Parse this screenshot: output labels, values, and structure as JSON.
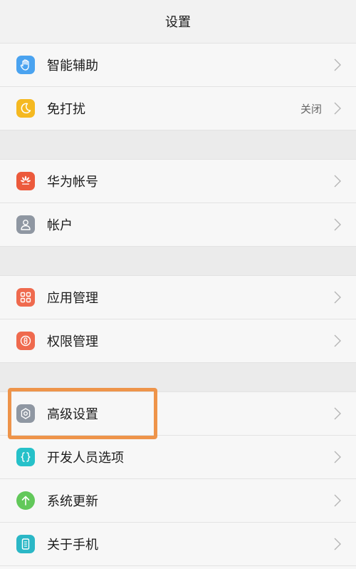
{
  "header": {
    "title": "设置"
  },
  "colors": {
    "highlight": "#ee944a",
    "icon_smart": "#4aa3f0",
    "icon_dnd": "#f5b921",
    "icon_huawei": "#ec5a3c",
    "icon_account": "#8f97a2",
    "icon_apps": "#ef6a4e",
    "icon_permission": "#ef6a4e",
    "icon_advanced": "#8f97a2",
    "icon_developer": "#26c1c9",
    "icon_update": "#62c85a",
    "icon_about": "#2bb7c6"
  },
  "rows": {
    "smart_assist": {
      "label": "智能辅助",
      "icon": "hand-icon"
    },
    "do_not_disturb": {
      "label": "免打扰",
      "value": "关闭",
      "icon": "moon-icon"
    },
    "huawei_account": {
      "label": "华为帐号",
      "icon": "huawei-logo-icon"
    },
    "accounts": {
      "label": "帐户",
      "icon": "person-icon"
    },
    "apps": {
      "label": "应用管理",
      "icon": "grid-icon"
    },
    "permissions": {
      "label": "权限管理",
      "icon": "shield-icon"
    },
    "advanced": {
      "label": "高级设置",
      "icon": "gear-icon"
    },
    "developer": {
      "label": "开发人员选项",
      "icon": "braces-icon"
    },
    "update": {
      "label": "系统更新",
      "icon": "arrow-up-icon"
    },
    "about": {
      "label": "关于手机",
      "icon": "phone-icon"
    }
  }
}
